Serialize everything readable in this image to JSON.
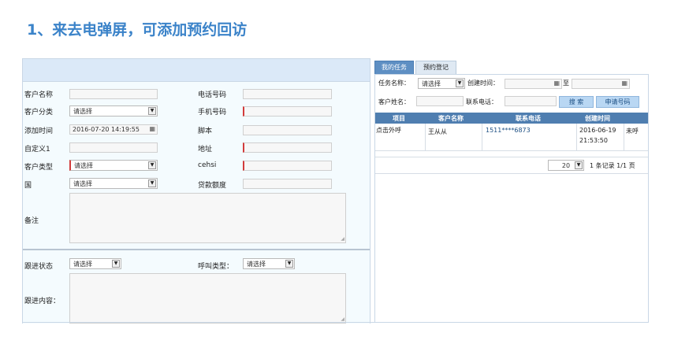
{
  "heading": "1、来去电弹屏，可添加预约回访",
  "form": {
    "customer_name_label": "客户名称",
    "phone_label": "电话号码",
    "category_label": "客户分类",
    "category_value": "请选择",
    "mobile_label": "手机号码",
    "added_time_label": "添加时间",
    "added_time_value": "2016-07-20 14:19:55",
    "script_label": "脚本",
    "custom1_label": "自定义1",
    "address_label": "地址",
    "type_label": "客户类型",
    "type_value": "请选择",
    "cehsi_label": "cehsi",
    "country_label": "国",
    "country_value": "请选择",
    "loan_label": "贷款额度",
    "remark_label": "备注",
    "follow_status_label": "跟进状态",
    "follow_status_value": "请选择",
    "call_type_label": "呼叫类型：",
    "call_type_value": "请选择",
    "follow_content_label": "跟进内容："
  },
  "tabs": [
    {
      "label": "我的任务"
    },
    {
      "label": "预约登记"
    }
  ],
  "filters": {
    "task_name_label": "任务名称：",
    "task_name_value": "请选择",
    "created_time_label": "创建时间：",
    "to_label": "至",
    "customer_name_label": "客户姓名：",
    "contact_phone_label": "联系电话：",
    "search_button": "搜 索",
    "apply_button": "申请号码"
  },
  "table": {
    "headers": [
      "项目",
      "客户名称",
      "联系电话",
      "创建时间"
    ],
    "rows": [
      {
        "project": "点击外呼",
        "customer": "王从从",
        "phone": "1511****6873",
        "created_date": "2016-06-19",
        "created_time": "21:53:50",
        "status": "未呼"
      }
    ]
  },
  "pager": {
    "page_size": "20",
    "summary": "1 条记录 1/1 页"
  },
  "colors": {
    "heading": "#3b83c9",
    "table_header": "#4f7eb0",
    "required": "#d23b3b"
  }
}
